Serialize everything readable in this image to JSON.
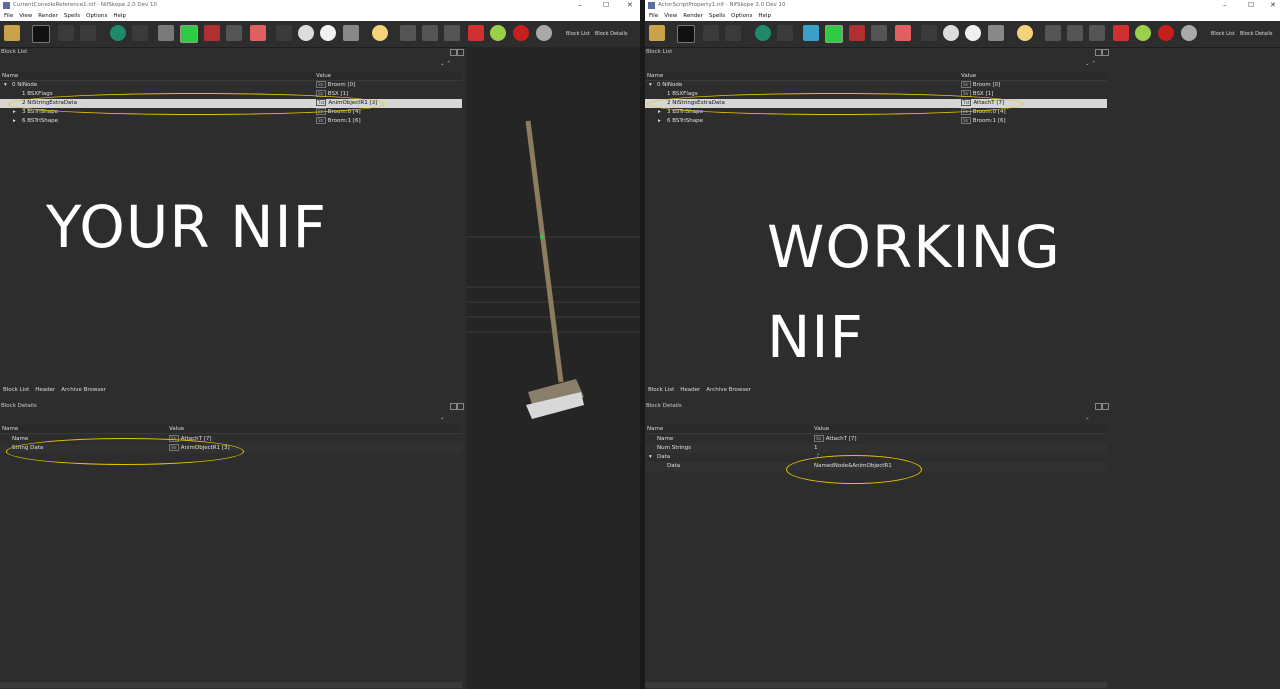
{
  "left": {
    "title": "CurrentConsoleReference1.nif - NifSkope 2.0 Dev 10",
    "menu": [
      "File",
      "View",
      "Render",
      "Spells",
      "Options",
      "Help"
    ],
    "toolbar_labels": {
      "block_list": "Block List",
      "block_details": "Block Details"
    },
    "block_list": {
      "panel_title": "Block List",
      "columns": {
        "name": "Name",
        "value": "Value"
      },
      "rows": [
        {
          "name": "0 NiNode",
          "value": "Broom [0]",
          "tag": "Str"
        },
        {
          "name": "1 BSXFlags",
          "value": "BSX [1]",
          "tag": "Str"
        },
        {
          "name": "2 NiStringExtraData",
          "value": "AnimObjectR1 [3]",
          "tag": "Txt"
        },
        {
          "name": "3 BSTriShape",
          "value": "Broom:0 [4]",
          "tag": "Str"
        },
        {
          "name": "6 BSTriShape",
          "value": "Broom:1 [6]",
          "tag": "Str"
        }
      ]
    },
    "overlay_text": "YOUR NIF",
    "tabs": [
      "Block List",
      "Header",
      "Archive Browser"
    ],
    "block_details": {
      "panel_title": "Block Details",
      "columns": {
        "name": "Name",
        "value": "Value"
      },
      "rows": [
        {
          "name": "Name",
          "value": "AttachT [7]",
          "tag": "Str"
        },
        {
          "name": "String Data",
          "value": "AnimObjectR1 [3]",
          "tag": "Str"
        }
      ]
    }
  },
  "right": {
    "title": "ActorScriptProperty1.nif - NifSkope 2.0 Dev 10",
    "menu": [
      "File",
      "View",
      "Render",
      "Spells",
      "Options",
      "Help"
    ],
    "toolbar_labels": {
      "block_list": "Block List",
      "block_details": "Block Details"
    },
    "block_list": {
      "panel_title": "Block List",
      "columns": {
        "name": "Name",
        "value": "Value"
      },
      "rows": [
        {
          "name": "0 NiNode",
          "value": "Broom [0]",
          "tag": "Str"
        },
        {
          "name": "1 BSXFlags",
          "value": "BSX [1]",
          "tag": "Str"
        },
        {
          "name": "2 NiStringsExtraData",
          "value": "AttachT [7]",
          "tag": "Txt"
        },
        {
          "name": "3 BSTriShape",
          "value": "Broom:0 [4]",
          "tag": "Str"
        },
        {
          "name": "6 BSTriShape",
          "value": "Broom:1 [6]",
          "tag": "Str"
        }
      ]
    },
    "overlay_text_1": "WORKING",
    "overlay_text_2": "NIF",
    "tabs": [
      "Block List",
      "Header",
      "Archive Browser"
    ],
    "block_details": {
      "panel_title": "Block Details",
      "columns": {
        "name": "Name",
        "value": "Value"
      },
      "rows": [
        {
          "name": "Name",
          "value": "AttachT [7]",
          "tag": "Str"
        },
        {
          "name": "Num Strings",
          "value": "1",
          "tag": ""
        },
        {
          "name": "Data",
          "value": "",
          "tag": ""
        },
        {
          "name": "Data",
          "value": "NamedNode&AnimObjectR1",
          "tag": ""
        }
      ]
    }
  },
  "colors": {
    "highlight": "#e8c200",
    "selected_row": "#d6d6d6",
    "background": "#2d2d2d"
  }
}
